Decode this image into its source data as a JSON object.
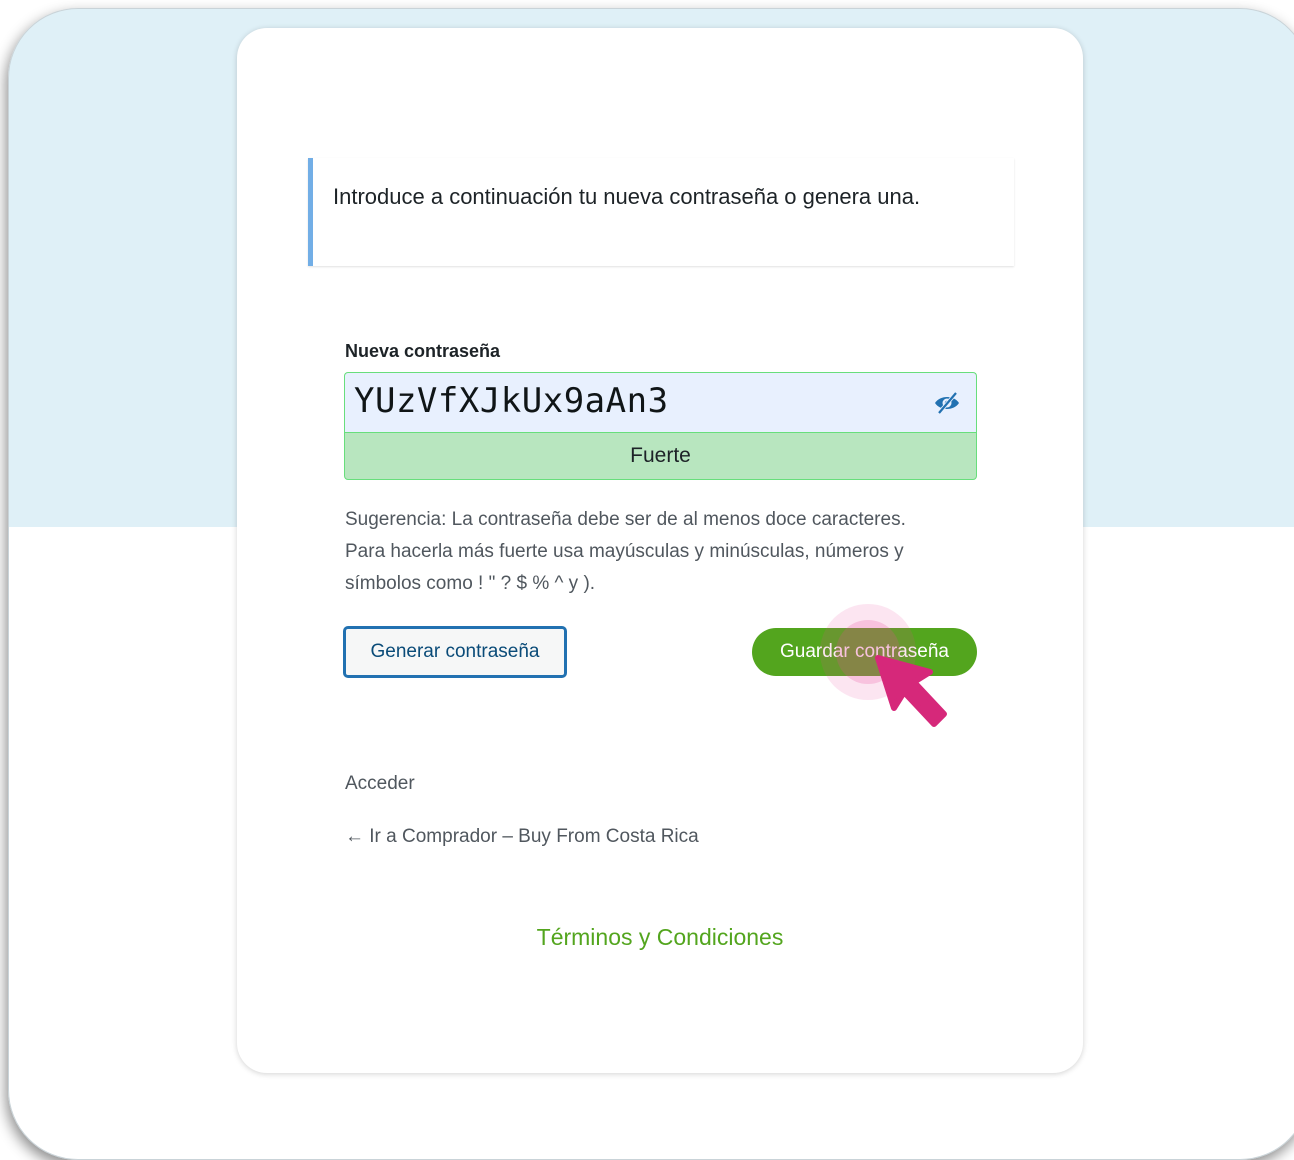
{
  "notice": {
    "text": "Introduce a continuación tu nueva contraseña o genera una."
  },
  "password": {
    "label": "Nueva contraseña",
    "value": "YUzVfXJkUx9aAn3",
    "strength": "Fuerte"
  },
  "hint": "Sugerencia: La contraseña debe ser de al menos doce caracteres. Para hacerla más fuerte usa mayúsculas y minúsculas, números y símbolos como ! \" ? $ % ^ y ).",
  "buttons": {
    "generate": "Generar contraseña",
    "save": "Guardar contraseña"
  },
  "links": {
    "login": "Acceder",
    "back": "← Ir a Comprador – Buy From Costa Rica",
    "terms": "Términos y Condiciones"
  },
  "colors": {
    "accent_green": "#53a51e",
    "strength_bg": "#b8e6bf",
    "notice_border": "#72aee6",
    "cursor": "#d6287a",
    "top_band": "#dff0f7"
  },
  "icons": {
    "visibility_toggle": "eye-slash-icon",
    "pointer": "cursor-arrow-icon"
  }
}
